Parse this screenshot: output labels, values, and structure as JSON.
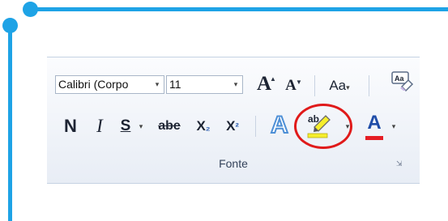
{
  "font_group": {
    "font_name": "Calibri (Corpo",
    "font_size": "11",
    "dropdown_arrow": "▾",
    "grow_label": "A",
    "shrink_label": "A",
    "case_label": "Aa",
    "bold_label": "N",
    "italic_label": "I",
    "underline_label": "S",
    "strike_label": "abe",
    "sub_label": "X",
    "sub_mark": "₂",
    "sup_label": "X",
    "sup_mark": "²",
    "effects_label": "A",
    "highlight_label": "ab",
    "fontcolor_label": "A",
    "group_label": "Fonte",
    "launcher_icon": "⇲"
  },
  "colors": {
    "frame": "#1ea3e6",
    "annotation": "#e01a1a",
    "font_color": "#e51d24",
    "highlight": "#f6ee2b"
  }
}
